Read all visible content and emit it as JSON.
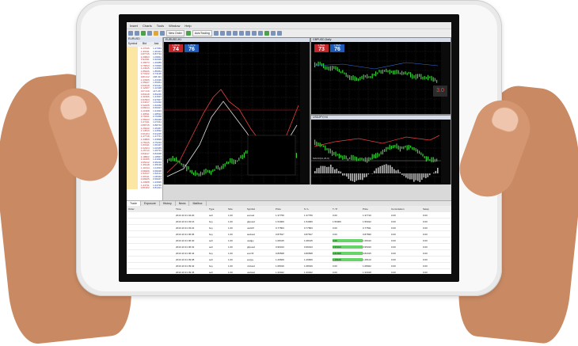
{
  "app": {
    "menu": [
      "Insert",
      "Charts",
      "Tools",
      "Window",
      "Help"
    ],
    "toolbar": {
      "new_order": "New Order",
      "auto_trading": "AutoTrading"
    }
  },
  "watch": {
    "title": "EURUSD",
    "headers": [
      "Symbol",
      "Bid",
      "Ask"
    ],
    "rows": [
      [
        "",
        "1.27045",
        "1.27053"
      ],
      [
        "",
        "1.36411",
        "1.36421"
      ],
      [
        "",
        "0.87715",
        "0.87734"
      ],
      [
        "",
        "1.09823",
        "1.09841"
      ],
      [
        "",
        "0.92011",
        "0.92025"
      ],
      [
        "",
        "1.49073",
        "1.49089"
      ],
      [
        "",
        "0.76813",
        "0.76829"
      ],
      [
        "",
        "1.24915",
        "1.24932"
      ],
      [
        "",
        "1.85026",
        "1.85054"
      ],
      [
        "",
        "0.73122",
        "0.73135"
      ],
      [
        "",
        "108.412",
        "108.431"
      ],
      [
        "",
        "1.43306",
        "1.43326"
      ],
      [
        "",
        "1.55027",
        "1.55051"
      ],
      [
        "",
        "0.93418",
        "0.93441"
      ],
      [
        "",
        "1.12407",
        "1.12428"
      ],
      [
        "",
        "147.216",
        "147.247"
      ],
      [
        "",
        "0.83218",
        "0.83239"
      ],
      [
        "",
        "1.31506",
        "1.31527"
      ],
      [
        "",
        "0.97823",
        "0.97847"
      ],
      [
        "",
        "1.04417",
        "1.04432"
      ],
      [
        "",
        "1.62235",
        "1.62262"
      ],
      [
        "",
        "0.66014",
        "0.66027"
      ],
      [
        "",
        "1.21908",
        "1.21923"
      ],
      [
        "",
        "1.38511",
        "1.38534"
      ],
      [
        "",
        "0.79341",
        "0.79358"
      ],
      [
        "",
        "1.56023",
        "1.56048"
      ],
      [
        "",
        "1.07211",
        "1.07231"
      ],
      [
        "",
        "0.88715",
        "0.88734"
      ],
      [
        "",
        "1.29442",
        "1.29467"
      ],
      [
        "",
        "1.14513",
        "1.14532"
      ],
      [
        "",
        "0.91204",
        "0.91225"
      ],
      [
        "",
        "1.47718",
        "1.47741"
      ],
      [
        "",
        "1.33809",
        "1.33828"
      ],
      [
        "",
        "0.75215",
        "0.75234"
      ],
      [
        "",
        "1.66411",
        "1.66437"
      ],
      [
        "",
        "1.02324",
        "1.02345"
      ],
      [
        "",
        "1.26713",
        "1.26731"
      ],
      [
        "",
        "0.84017",
        "0.84038"
      ],
      [
        "",
        "1.18822",
        "1.18847"
      ],
      [
        "",
        "1.41006",
        "1.41024"
      ],
      [
        "",
        "0.95212",
        "0.95233"
      ],
      [
        "",
        "1.35118",
        "1.35139"
      ],
      [
        "",
        "1.11614",
        "1.11633"
      ],
      [
        "",
        "0.68209",
        "0.68228"
      ],
      [
        "",
        "1.52117",
        "1.52141"
      ],
      [
        "",
        "1.08411",
        "1.08432"
      ],
      [
        "",
        "0.99025",
        "0.99047"
      ],
      [
        "",
        "1.23908",
        "1.23926"
      ],
      [
        "",
        "1.44711",
        "1.44736"
      ],
      [
        "",
        "0.81302",
        "0.81321"
      ]
    ]
  },
  "charts": {
    "main": {
      "title": "EURUSD,H1",
      "sell_small": "1.3570",
      "sell_big": "74",
      "buy_small": "1.3570",
      "buy_big": "76"
    },
    "top_right": {
      "title": "GBPUSD,Daily",
      "sell_small": "1.5621",
      "sell_big": "73",
      "buy_small": "1.5621",
      "buy_big": "76",
      "side_label": "3.0"
    },
    "bottom_right": {
      "title": "USDJPY,H4",
      "osc_label": "MACD(12,26,9)"
    }
  },
  "tabs": [
    "Trade",
    "Exposure",
    "History",
    "News",
    "Mailbox"
  ],
  "terminal": {
    "headers": [
      "Order",
      "Time",
      "Type",
      "Size",
      "Symbol",
      "Price",
      "S / L",
      "T / P",
      "Price",
      "Commission",
      "Swap"
    ],
    "rows": [
      [
        "",
        "2013.10.31 04:20",
        "sell",
        "1.00",
        "eurusd",
        "1.37759",
        "1.37759",
        "0.00",
        "1.37710",
        "0.00",
        "0.00"
      ],
      [
        "",
        "2013.10.31 03:16",
        "buy",
        "1.00",
        "gbpusd",
        "1.54009",
        "1.54009",
        "1.56009",
        "1.56012",
        "0.00",
        "0.00"
      ],
      [
        "",
        "2013.10.31 03:22",
        "buy",
        "1.00",
        "usdchf",
        "0.77803",
        "0.77803",
        "0.00",
        "0.77811",
        "0.00",
        "0.00"
      ],
      [
        "",
        "2013.10.31 06:06",
        "buy",
        "1.00",
        "audusd",
        "0.87817",
        "0.87817",
        "0.00",
        "0.87830",
        "0.00",
        "0.00"
      ],
      [
        "",
        "2013.10.31 06:40",
        "sell",
        "1.00",
        "usdjpy",
        "1.08415",
        "1.08415",
        "0.00",
        "1.08410",
        "0.00",
        "0.00"
      ],
      [
        "",
        "2013.10.31 06:32",
        "sell",
        "1.00",
        "gbpusd",
        "0.96013",
        "0.96013",
        "0.95013",
        "0.95016",
        "0.00",
        "0.00"
      ],
      [
        "",
        "2013.10.31 06:44",
        "buy",
        "1.00",
        "eurchf",
        "0.80508",
        "0.80508",
        "0.82008",
        "0.82015",
        "0.00",
        "0.00"
      ],
      [
        "",
        "2013.10.31 09:08",
        "sell",
        "1.00",
        "eurjpy",
        "1.29609",
        "1.29609",
        "1.28109",
        "1.28110",
        "0.00",
        "0.00"
      ],
      [
        "",
        "2013.10.31 09:42",
        "buy",
        "1.00",
        "nzdusd",
        "1.08019",
        "1.08019",
        "0.00",
        "1.08022",
        "0.00",
        "0.00"
      ],
      [
        "",
        "2013.10.31 09:45",
        "sell",
        "1.00",
        "usdcad",
        "1.33022",
        "1.33022",
        "0.00",
        "1.33018",
        "0.00",
        "0.00"
      ],
      [
        "",
        "2013.10.31 09:57",
        "sell",
        "1.00",
        "eurgbp",
        "1.06019",
        "1.06019",
        "0.00",
        "1.06015",
        "0.00",
        "0.00"
      ]
    ],
    "highlight_tp_rows": [
      4,
      5,
      6,
      7
    ]
  }
}
